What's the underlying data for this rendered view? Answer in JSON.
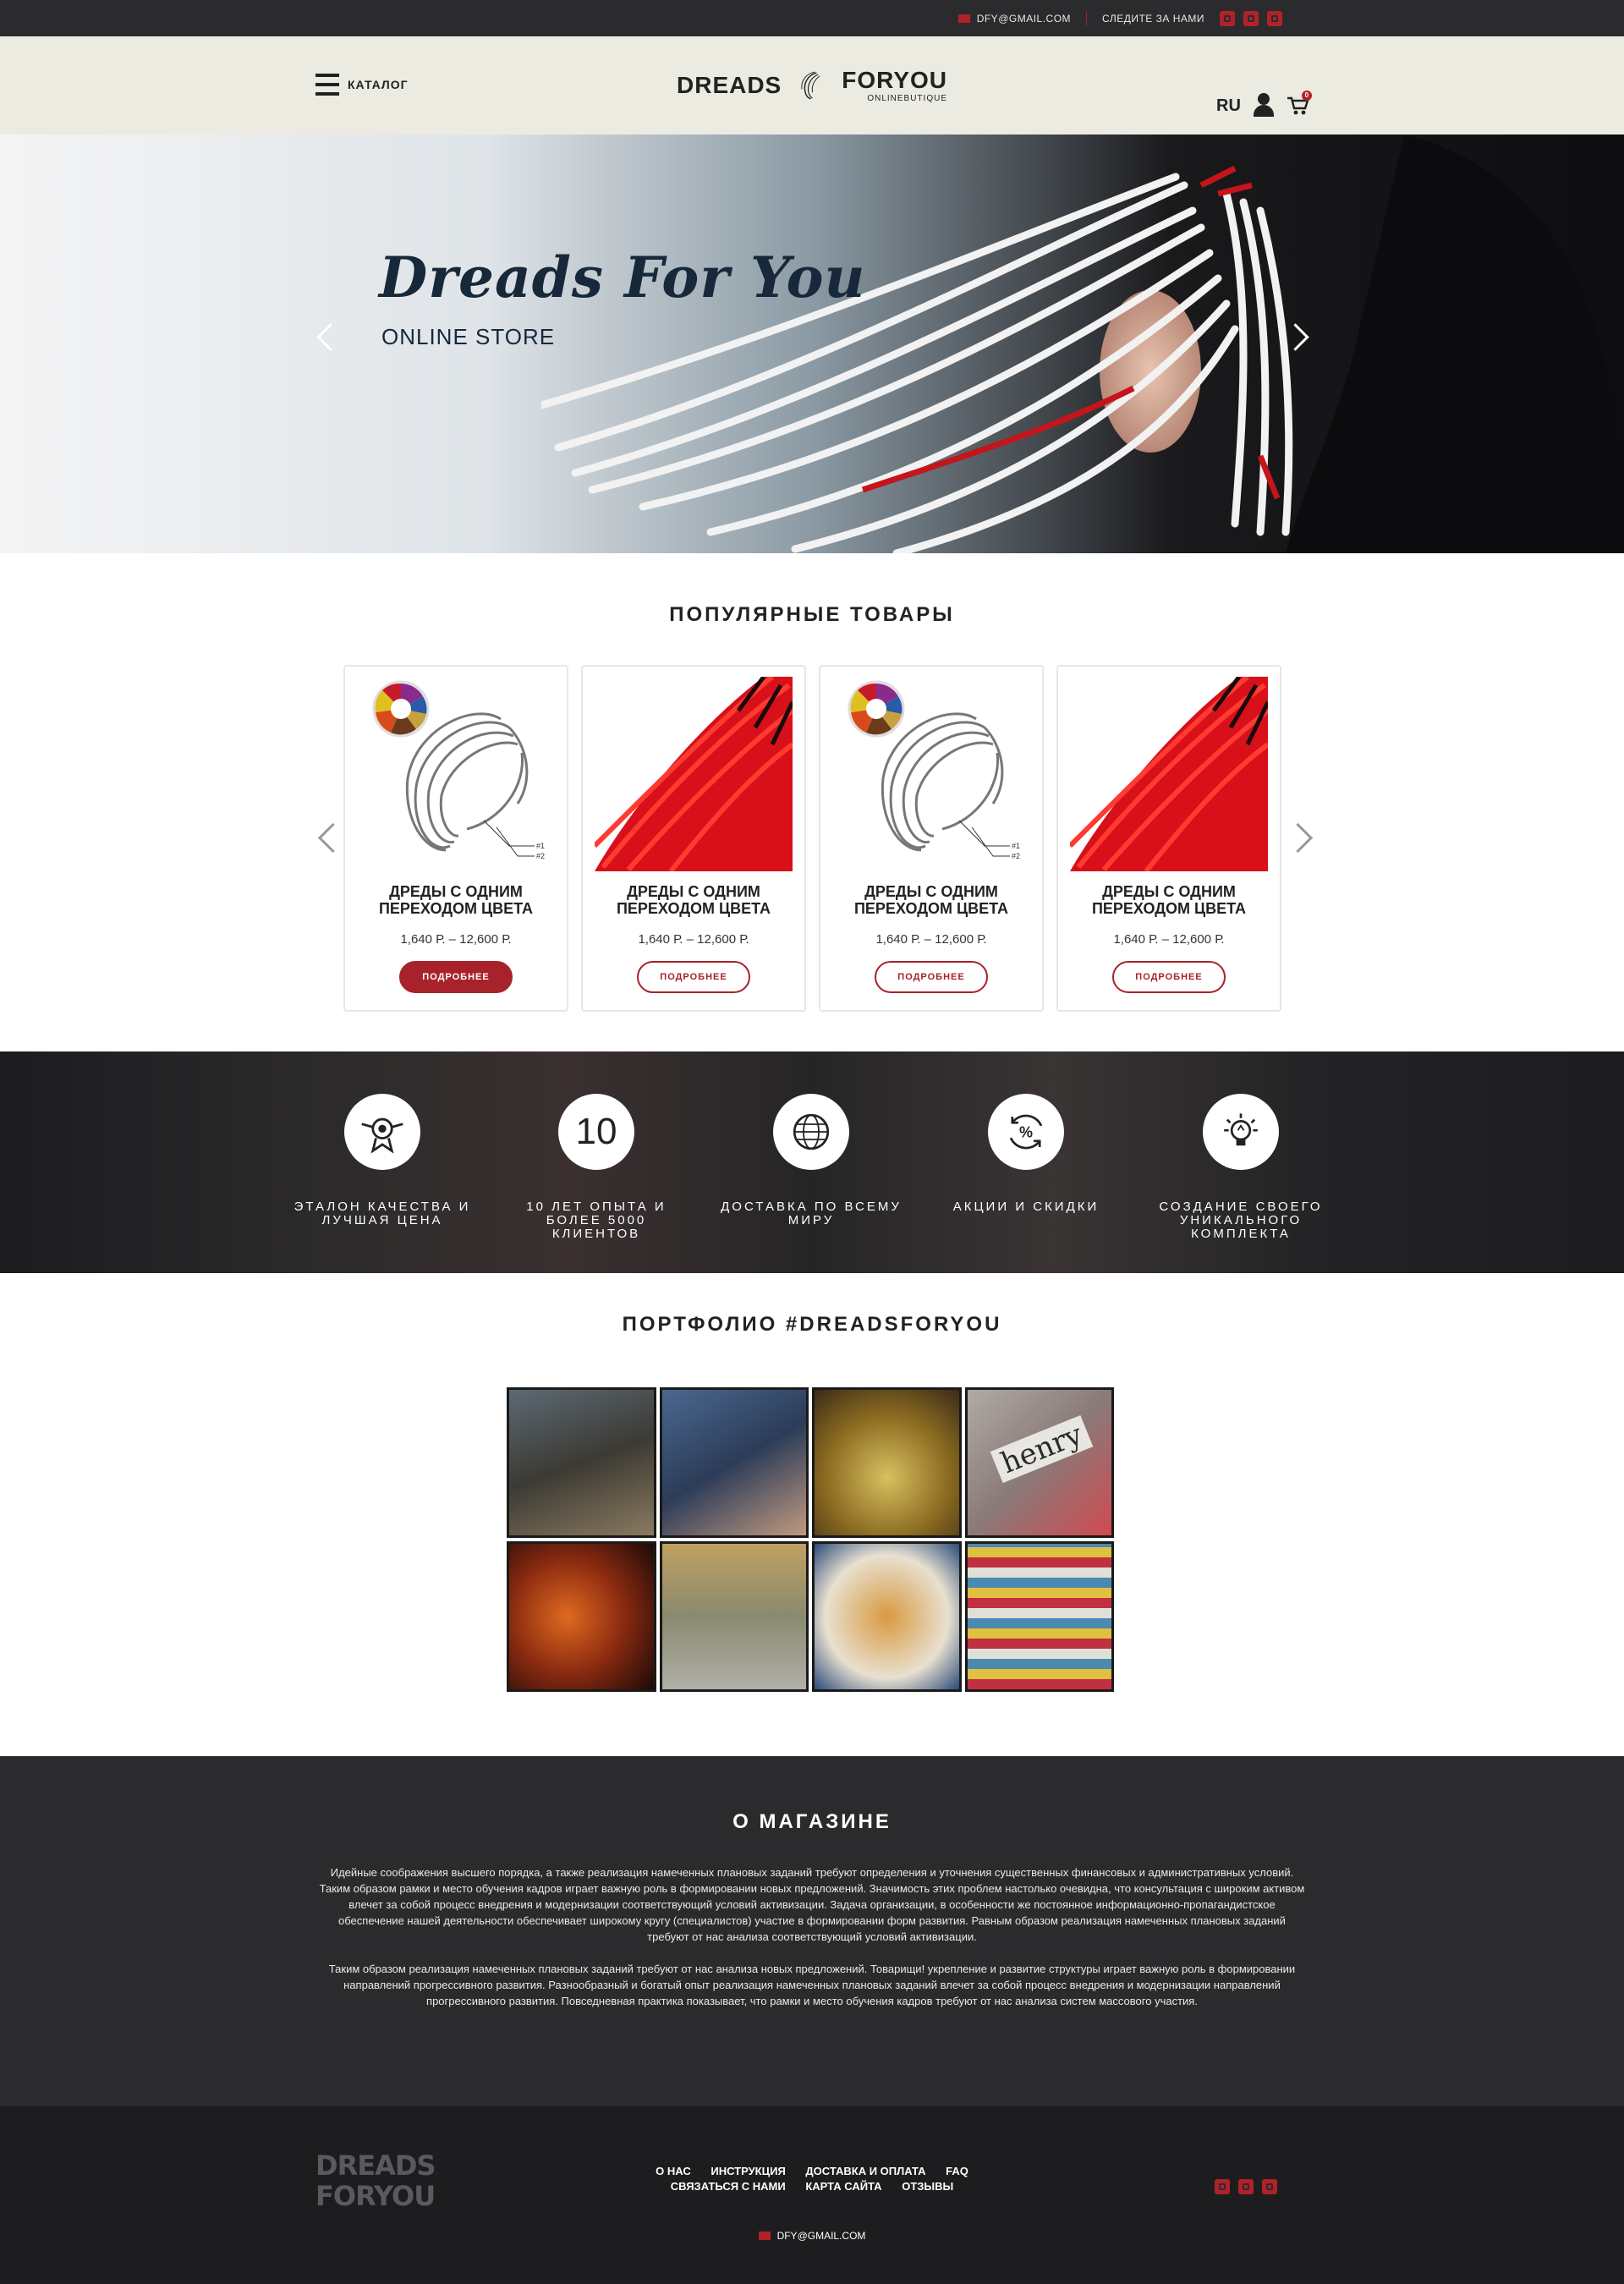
{
  "topbar": {
    "email": "DFY@GMAIL.COM",
    "follow": "СЛЕДИТЕ ЗА НАМИ"
  },
  "header": {
    "catalog": "КАТАЛОГ",
    "logo_left": "DREADS",
    "logo_right": "FORYOU",
    "logo_sub": "ONLINEBUTIQUE",
    "lang": "RU",
    "cart_count": "0"
  },
  "hero": {
    "title": "Dreads For You",
    "subtitle": "ONLINE STORE"
  },
  "popular": {
    "title": "ПОПУЛЯРНЫЕ ТОВАРЫ",
    "products": [
      {
        "name": "ДРЕДЫ С ОДНИМ ПЕРЕХОДОМ ЦВЕТА",
        "price": "1,640 Р. – 12,600 Р.",
        "button": "ПОДРОБНЕЕ"
      },
      {
        "name": "ДРЕДЫ С ОДНИМ ПЕРЕХОДОМ ЦВЕТА",
        "price": "1,640 Р. – 12,600 Р.",
        "button": "ПОДРОБНЕЕ"
      },
      {
        "name": "ДРЕДЫ С ОДНИМ ПЕРЕХОДОМ ЦВЕТА",
        "price": "1,640 Р. – 12,600 Р.",
        "button": "ПОДРОБНЕЕ"
      },
      {
        "name": "ДРЕДЫ С ОДНИМ ПЕРЕХОДОМ ЦВЕТА",
        "price": "1,640 Р. – 12,600 Р.",
        "button": "ПОДРОБНЕЕ"
      }
    ],
    "diagram_labels": [
      "#1",
      "#2"
    ]
  },
  "features": [
    {
      "label": "ЭТАЛОН КАЧЕСТВА И ЛУЧШАЯ ЦЕНА"
    },
    {
      "icon_text": "10",
      "label": "10 ЛЕТ ОПЫТА И БОЛЕЕ 5000 КЛИЕНТОВ"
    },
    {
      "label": "ДОСТАВКА ПО ВСЕМУ МИРУ"
    },
    {
      "icon_text": "%",
      "label": "АКЦИИ И СКИДКИ"
    },
    {
      "label": "СОЗДАНИЕ СВОЕГО УНИКАЛЬНОГО КОМПЛЕКТА"
    }
  ],
  "portfolio": {
    "title": "ПОРТФОЛИО #DREADSFORYOU",
    "photo_text": "henry"
  },
  "about": {
    "title": "О МАГАЗИНЕ",
    "p1": "Идейные соображения высшего порядка, а также реализация намеченных плановых заданий требуют определения и уточнения существенных финансовых и административных условий. Таким образом рамки и место обучения кадров играет важную роль в формировании новых предложений. Значимость этих проблем настолько очевидна, что консультация с широким активом влечет за собой процесс внедрения и модернизации соответствующий условий активизации. Задача организации, в особенности же постоянное информационно-пропагандистское обеспечение нашей деятельности обеспечивает широкому кругу (специалистов) участие в формировании форм развития. Равным образом реализация намеченных плановых заданий требуют от нас анализа соответствующий условий активизации.",
    "p2": "Таким образом реализация намеченных плановых заданий требуют от нас анализа новых предложений. Товарищи! укрепление и развитие структуры играет важную роль в формировании направлений прогрессивного развития. Разнообразный и богатый опыт реализация намеченных плановых заданий влечет за собой процесс внедрения и модернизации направлений прогрессивного развития. Повседневная практика показывает, что рамки и место обучения кадров требуют от нас анализа систем массового участия."
  },
  "footer": {
    "logo_line1": "DREADS",
    "logo_line2": "FORYOU",
    "nav1": [
      "О НАС",
      "ИНСТРУКЦИЯ",
      "ДОСТАВКА И ОПЛАТА",
      "FAQ"
    ],
    "nav2": [
      "СВЯЗАТЬСЯ С НАМИ",
      "КАРТА САЙТА",
      "ОТЗЫВЫ"
    ],
    "email": "DFY@GMAIL.COM"
  },
  "colors": {
    "accent": "#a8222b",
    "dark": "#2b2b2e",
    "header_bg": "#ecebe2"
  }
}
